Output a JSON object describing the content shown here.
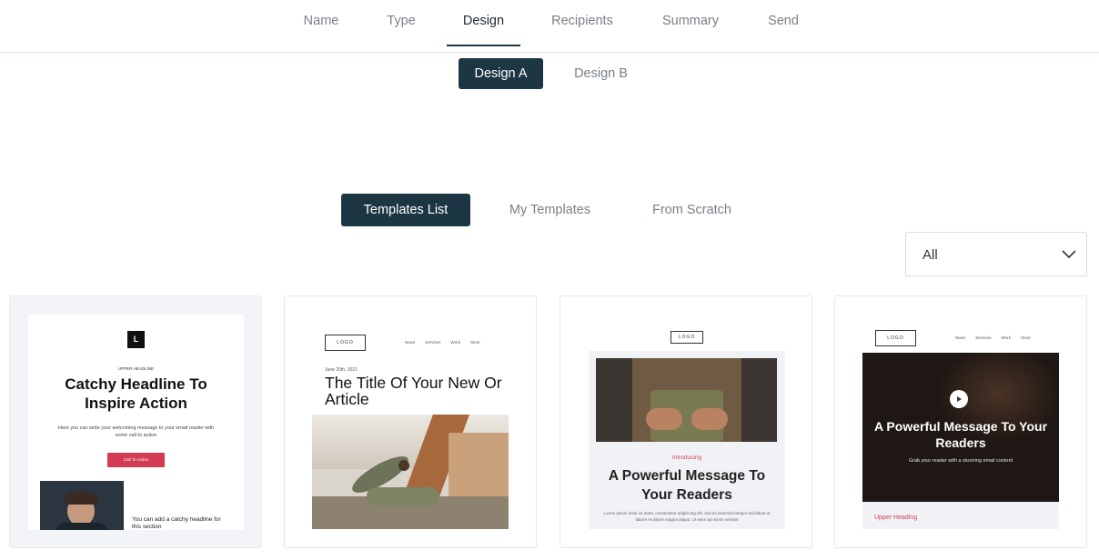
{
  "steps": [
    "Name",
    "Type",
    "Design",
    "Recipients",
    "Summary",
    "Send"
  ],
  "design_variants": {
    "a": "Design A",
    "b": "Design B"
  },
  "template_sources": {
    "list": "Templates List",
    "mine": "My Templates",
    "scratch": "From Scratch"
  },
  "filter": {
    "selected": "All"
  },
  "colors": {
    "primary": "#1d3644",
    "accent": "#d23b53",
    "muted": "#7a8088"
  },
  "templates": [
    {
      "logo": "L",
      "upper_heading": "UPPER HEADLINE",
      "headline": "Catchy Headline To Inspire Action",
      "body": "Here you can write your welcoming message to your email reader with some call to action",
      "cta": "Call To Action",
      "side_text": "You can add a catchy headline for this section"
    },
    {
      "logo": "LOGO",
      "nav": [
        "News",
        "Services",
        "Work",
        "Store"
      ],
      "date": "June 20th, 2021",
      "title": "The Title Of Your New Or Article"
    },
    {
      "logo": "LOGO",
      "intro": "Introducing",
      "headline": "A Powerful Message To Your Readers",
      "body": "Lorem ipsum dolor sit amet, consectetur adipiscing elit, sed do eiusmod tempor incididunt ut labore et dolore magna aliqua. Ut enim ad minim veniam"
    },
    {
      "logo": "LOGO",
      "nav": [
        "News",
        "Services",
        "Work",
        "Store"
      ],
      "headline": "A Powerful Message To Your Readers",
      "sub": "Grab your reader with a stunning email content",
      "upper_heading": "Upper Heading"
    }
  ]
}
